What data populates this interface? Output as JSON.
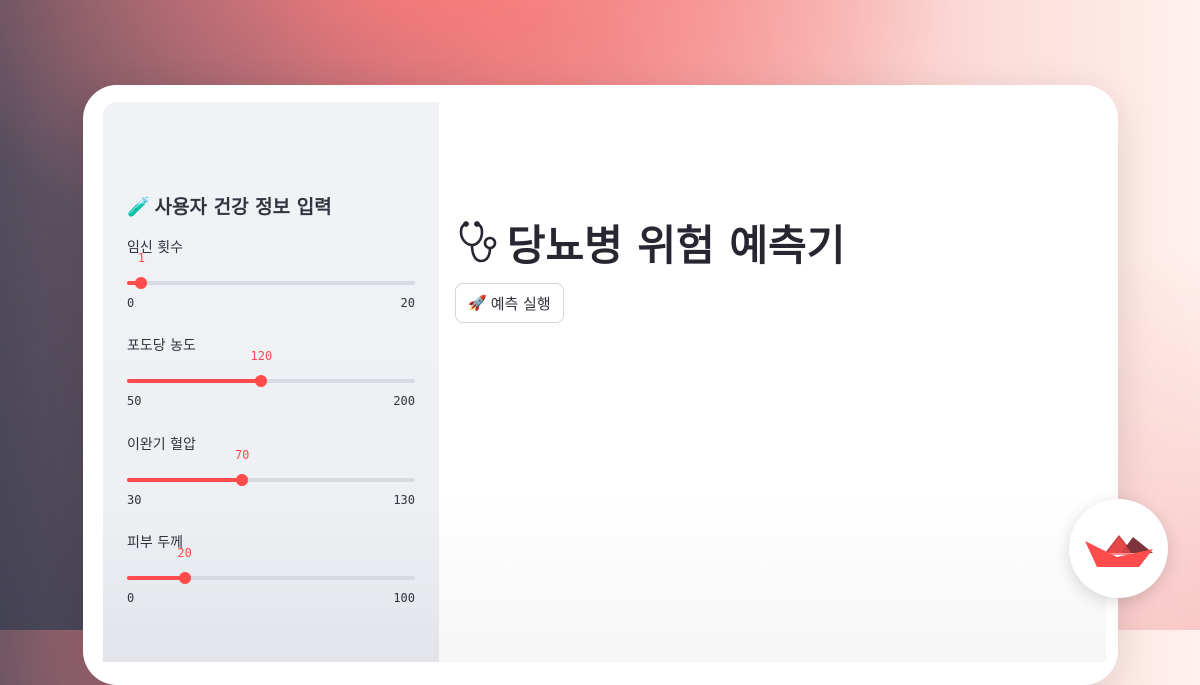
{
  "sidebar": {
    "title_emoji": "🧪",
    "title": "사용자 건강 정보 입력",
    "sliders": [
      {
        "label": "임신 횟수",
        "value": 1,
        "value_text": "1",
        "min": 0,
        "max": 20,
        "min_text": "0",
        "max_text": "20"
      },
      {
        "label": "포도당 농도",
        "value": 120,
        "value_text": "120",
        "min": 50,
        "max": 200,
        "min_text": "50",
        "max_text": "200"
      },
      {
        "label": "이완기 혈압",
        "value": 70,
        "value_text": "70",
        "min": 30,
        "max": 130,
        "min_text": "30",
        "max_text": "130"
      },
      {
        "label": "피부 두께",
        "value": 20,
        "value_text": "20",
        "min": 0,
        "max": 100,
        "min_text": "0",
        "max_text": "100"
      }
    ]
  },
  "main": {
    "title_icon": "stethoscope-icon",
    "title": "당뇨병 위험 예측기",
    "run_button": {
      "emoji": "🚀",
      "label": "예측 실행"
    }
  },
  "logo": {
    "icon": "streamlit-logo-icon"
  },
  "colors": {
    "accent": "#ff4b4b",
    "track": "#d6d9e1",
    "sidebar_bg": "#f0f2f6",
    "text": "#31333f"
  }
}
